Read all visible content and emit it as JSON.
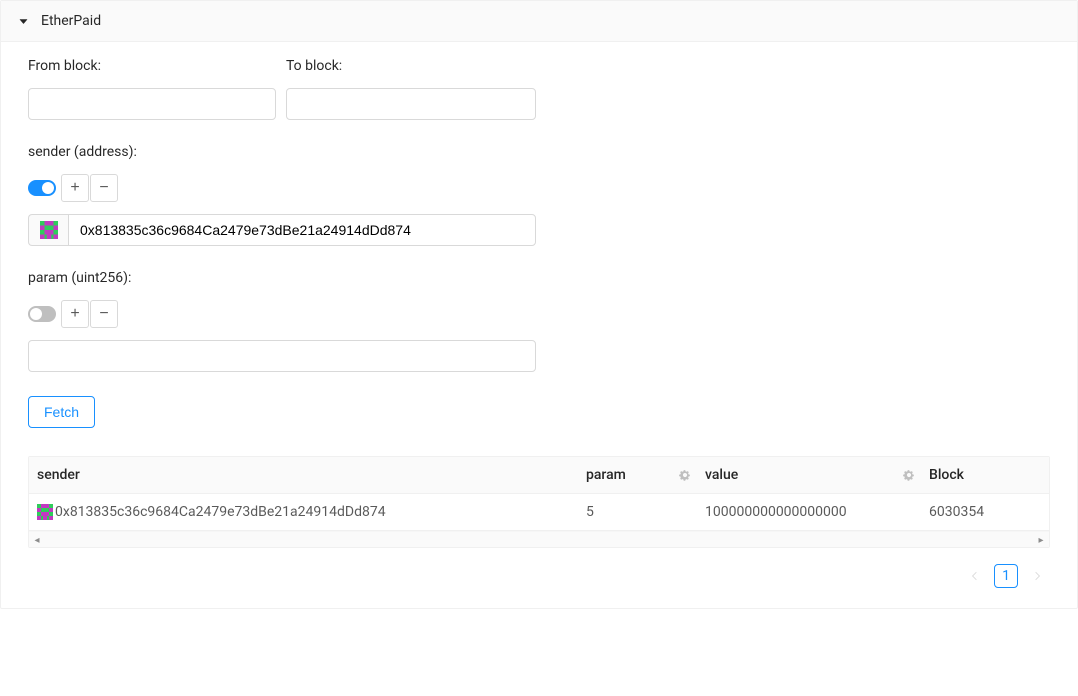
{
  "panel": {
    "title": "EtherPaid"
  },
  "blockRange": {
    "from_label": "From block:",
    "to_label": "To block:",
    "from_value": "",
    "to_value": ""
  },
  "sender": {
    "label": "sender (address):",
    "toggle_on": true,
    "value": "0x813835c36c9684Ca2479e73dBe21a24914dDd874"
  },
  "param": {
    "label": "param (uint256):",
    "toggle_on": false,
    "value": ""
  },
  "fetch": {
    "label": "Fetch"
  },
  "table": {
    "headers": {
      "sender": "sender",
      "param": "param",
      "value": "value",
      "block": "Block"
    },
    "rows": [
      {
        "sender": "0x813835c36c9684Ca2479e73dBe21a24914dDd874",
        "param": "5",
        "value": "100000000000000000",
        "block": "6030354"
      }
    ]
  },
  "pagination": {
    "current": "1"
  }
}
